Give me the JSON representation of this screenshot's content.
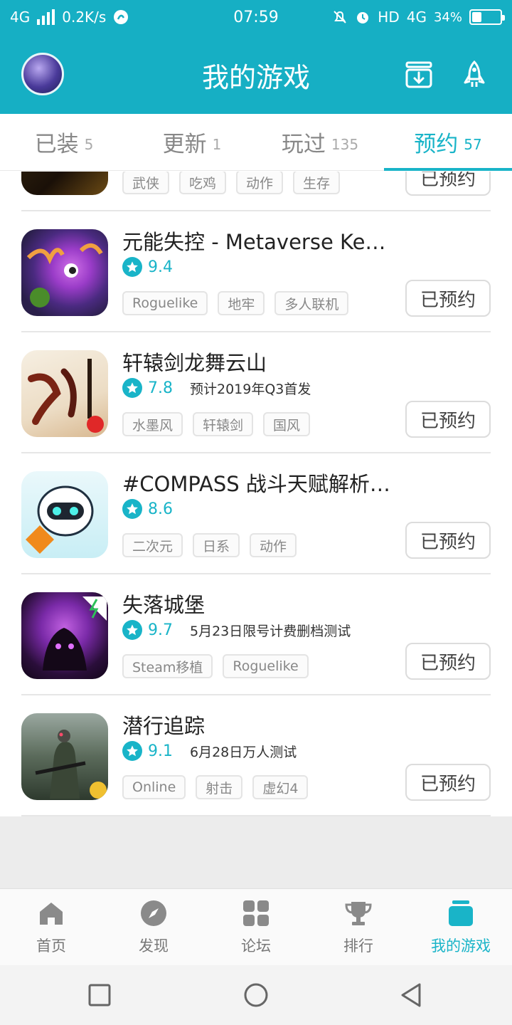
{
  "status_bar": {
    "network": "4G",
    "speed": "0.2K/s",
    "time": "07:59",
    "hd": "HD",
    "network_right": "4G",
    "battery": "34%",
    "battery_level": 0.34
  },
  "header": {
    "title": "我的游戏"
  },
  "tabs": [
    {
      "label": "已装",
      "count": "5"
    },
    {
      "label": "更新",
      "count": "1"
    },
    {
      "label": "玩过",
      "count": "135"
    },
    {
      "label": "预约",
      "count": "57",
      "active": true
    }
  ],
  "games": [
    {
      "name": "",
      "score": "",
      "note": "",
      "tags": [
        "武侠",
        "吃鸡",
        "动作",
        "生存"
      ],
      "button": "已预约",
      "icon": "game-icon-partial"
    },
    {
      "name": "元能失控 - Metaverse Keeper",
      "score": "9.4",
      "note": "",
      "tags": [
        "Roguelike",
        "地牢",
        "多人联机"
      ],
      "button": "已预约",
      "icon": "purple-monster-game-icon"
    },
    {
      "name": "轩辕剑龙舞云山",
      "score": "7.8",
      "note": "预计2019年Q3首发",
      "tags": [
        "水墨风",
        "轩辕剑",
        "国风"
      ],
      "button": "已预约",
      "icon": "xuanyuan-sword-game-icon"
    },
    {
      "name": "#COMPASS 战斗天赋解析系统",
      "score": "8.6",
      "note": "",
      "tags": [
        "二次元",
        "日系",
        "动作"
      ],
      "button": "已预约",
      "icon": "robot-character-game-icon"
    },
    {
      "name": "失落城堡",
      "score": "9.7",
      "note": "5月23日限号计费删档测试",
      "tags": [
        "Steam移植",
        "Roguelike"
      ],
      "button": "已预约",
      "icon": "lost-castle-game-icon"
    },
    {
      "name": "潜行追踪",
      "score": "9.1",
      "note": "6月28日万人测试",
      "tags": [
        "Online",
        "射击",
        "虚幻4"
      ],
      "button": "已预约",
      "icon": "soldier-game-icon"
    }
  ],
  "bottom_nav": [
    {
      "label": "首页",
      "icon": "home-icon"
    },
    {
      "label": "发现",
      "icon": "compass-icon"
    },
    {
      "label": "论坛",
      "icon": "forum-grid-icon"
    },
    {
      "label": "排行",
      "icon": "trophy-icon"
    },
    {
      "label": "我的游戏",
      "icon": "my-games-icon",
      "active": true
    }
  ],
  "colors": {
    "accent": "#19b4c8",
    "header_bg": "#16afc4"
  }
}
